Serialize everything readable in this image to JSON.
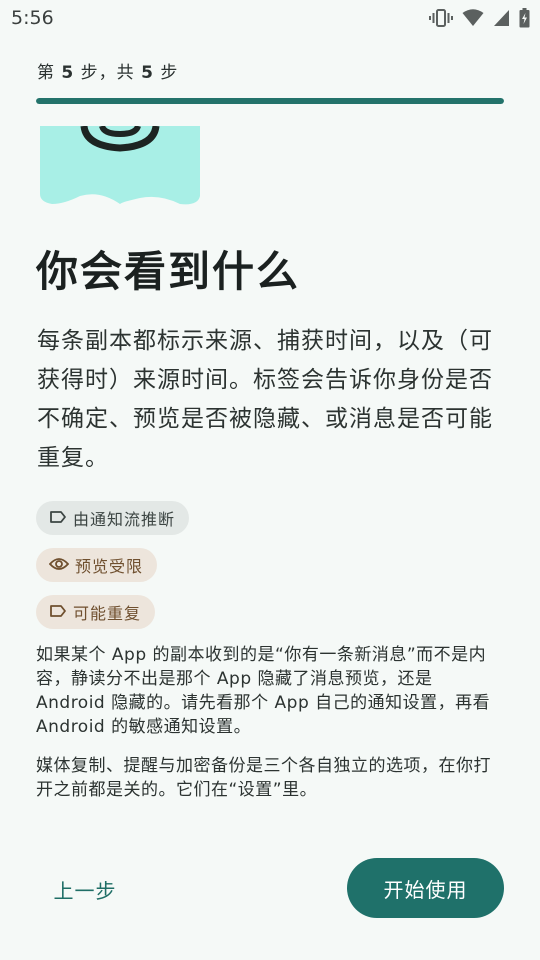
{
  "status_bar": {
    "time": "5:56",
    "icons": [
      "vibrate-icon",
      "wifi-icon",
      "cell-signal-icon",
      "battery-icon"
    ]
  },
  "progress": {
    "step_prefix": "第",
    "step_current": "5",
    "step_mid": "步，共",
    "step_total": "5",
    "step_suffix": "步",
    "fraction": 1.0,
    "fill_color": "#23736b"
  },
  "content": {
    "title": "你会看到什么",
    "body": "每条副本都标示来源、捕获时间，以及（可获得时）来源时间。标签会告诉你身份是否不确定、预览是否被隐藏、或消息是否可能重复。",
    "chips": [
      {
        "label": "由通知流推断",
        "icon": "tag-icon",
        "color": "#e3e8e6"
      },
      {
        "label": "预览受限",
        "icon": "eye-icon",
        "color": "#ede5dc"
      },
      {
        "label": "可能重复",
        "icon": "tag-icon",
        "color": "#ede5dc"
      }
    ],
    "note_1": "如果某个 App 的副本收到的是“你有一条新消息”而不是内容，静读分不出是那个 App 隐藏了消息预览，还是 Android 隐藏的。请先看那个 App 自己的通知设置，再看 Android 的敏感通知设置。",
    "note_2": "媒体复制、提醒与加密备份是三个各自独立的选项，在你打开之前都是关的。它们在“设置”里。"
  },
  "actions": {
    "back_label": "上一步",
    "start_label": "开始使用",
    "accent_color": "#1f716a"
  }
}
